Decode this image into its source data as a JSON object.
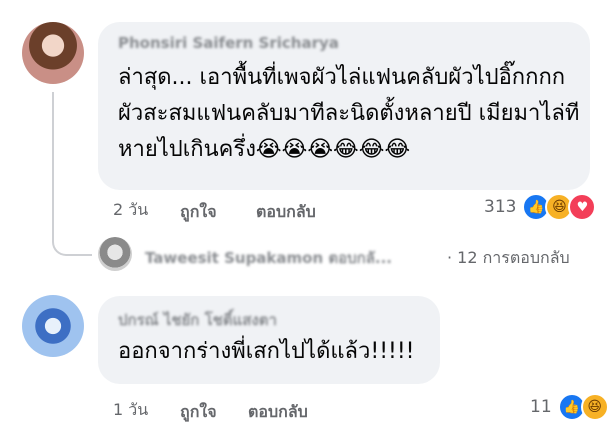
{
  "comments": [
    {
      "author": "Phonsiri Saifern Sricharya",
      "text": "ล่าสุด... เอาพื้นที่เพจผัวไล่แฟนคลับผัวไปอิ๊กกกก ผัวสะสมแฟนคลับมาทีละนิดตั้งหลายปี เมียมาไล่ทีหายไปเกินครึ่ง😭😭😭😂😂😂",
      "time": "2 วัน",
      "like_label": "ถูกใจ",
      "reply_label": "ตอบกลับ",
      "reaction_count": "313",
      "reactions": [
        "like",
        "haha",
        "love"
      ]
    },
    {
      "author": "ปกรณ์ ไชยัก โชติ์แสงตา",
      "text": "ออกจากร่างพี่เสกไปได้แล้ว!!!!!",
      "time": "1 วัน",
      "like_label": "ถูกใจ",
      "reply_label": "ตอบกลับ",
      "reaction_count": "11",
      "reactions": [
        "like",
        "haha"
      ]
    }
  ],
  "reply_summary": {
    "author": "Taweesit Supakamon ตอบกลั...",
    "text": "· 12 การตอบกลับ"
  },
  "icons": {
    "like": "like-icon",
    "haha": "haha-icon",
    "love": "love-icon"
  },
  "colors": {
    "bubble": "#f0f2f5",
    "meta_text": "#65676b",
    "like_blue": "#1877f2",
    "love_red": "#f33e58",
    "haha_yellow": "#f7b125"
  }
}
